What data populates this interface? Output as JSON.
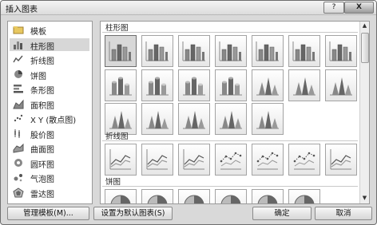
{
  "window": {
    "title": "插入图表",
    "help_label": "?",
    "close_label": "X"
  },
  "categories": [
    {
      "label": "模板",
      "icon": "folder-icon"
    },
    {
      "label": "柱形图",
      "icon": "column-chart-icon",
      "selected": true
    },
    {
      "label": "折线图",
      "icon": "line-chart-icon"
    },
    {
      "label": "饼图",
      "icon": "pie-chart-icon"
    },
    {
      "label": "条形图",
      "icon": "bar-chart-icon"
    },
    {
      "label": "面积图",
      "icon": "area-chart-icon"
    },
    {
      "label": "X Y (散点图)",
      "icon": "scatter-chart-icon"
    },
    {
      "label": "股价图",
      "icon": "stock-chart-icon"
    },
    {
      "label": "曲面图",
      "icon": "surface-chart-icon"
    },
    {
      "label": "圆环图",
      "icon": "doughnut-chart-icon"
    },
    {
      "label": "气泡图",
      "icon": "bubble-chart-icon"
    },
    {
      "label": "雷达图",
      "icon": "radar-chart-icon"
    }
  ],
  "sections": [
    {
      "title": "柱形图",
      "icons": [
        "clustered-column-icon",
        "stacked-column-icon",
        "percent-stacked-column-icon",
        "3d-clustered-column-icon",
        "3d-stacked-column-icon",
        "3d-percent-stacked-column-icon",
        "3d-column-icon",
        "clustered-cylinder-icon",
        "stacked-cylinder-icon",
        "percent-stacked-cylinder-icon",
        "3d-cylinder-icon",
        "clustered-cone-icon",
        "stacked-cone-icon",
        "percent-stacked-cone-icon",
        "3d-cone-icon",
        "clustered-pyramid-icon",
        "stacked-pyramid-icon",
        "percent-stacked-pyramid-icon",
        "3d-pyramid-icon"
      ]
    },
    {
      "title": "折线图",
      "icons": [
        "line-icon",
        "stacked-line-icon",
        "percent-stacked-line-icon",
        "line-markers-icon",
        "stacked-line-markers-icon",
        "percent-stacked-line-markers-icon",
        "3d-line-icon"
      ]
    },
    {
      "title": "饼图",
      "icons": [
        "pie-icon",
        "3d-pie-icon",
        "pie-of-pie-icon",
        "exploded-pie-icon",
        "3d-exploded-pie-icon",
        "bar-of-pie-icon"
      ]
    }
  ],
  "buttons": {
    "manage": "管理模板(M)...",
    "default": "设置为默认图表(S)",
    "ok": "确定",
    "cancel": "取消"
  }
}
